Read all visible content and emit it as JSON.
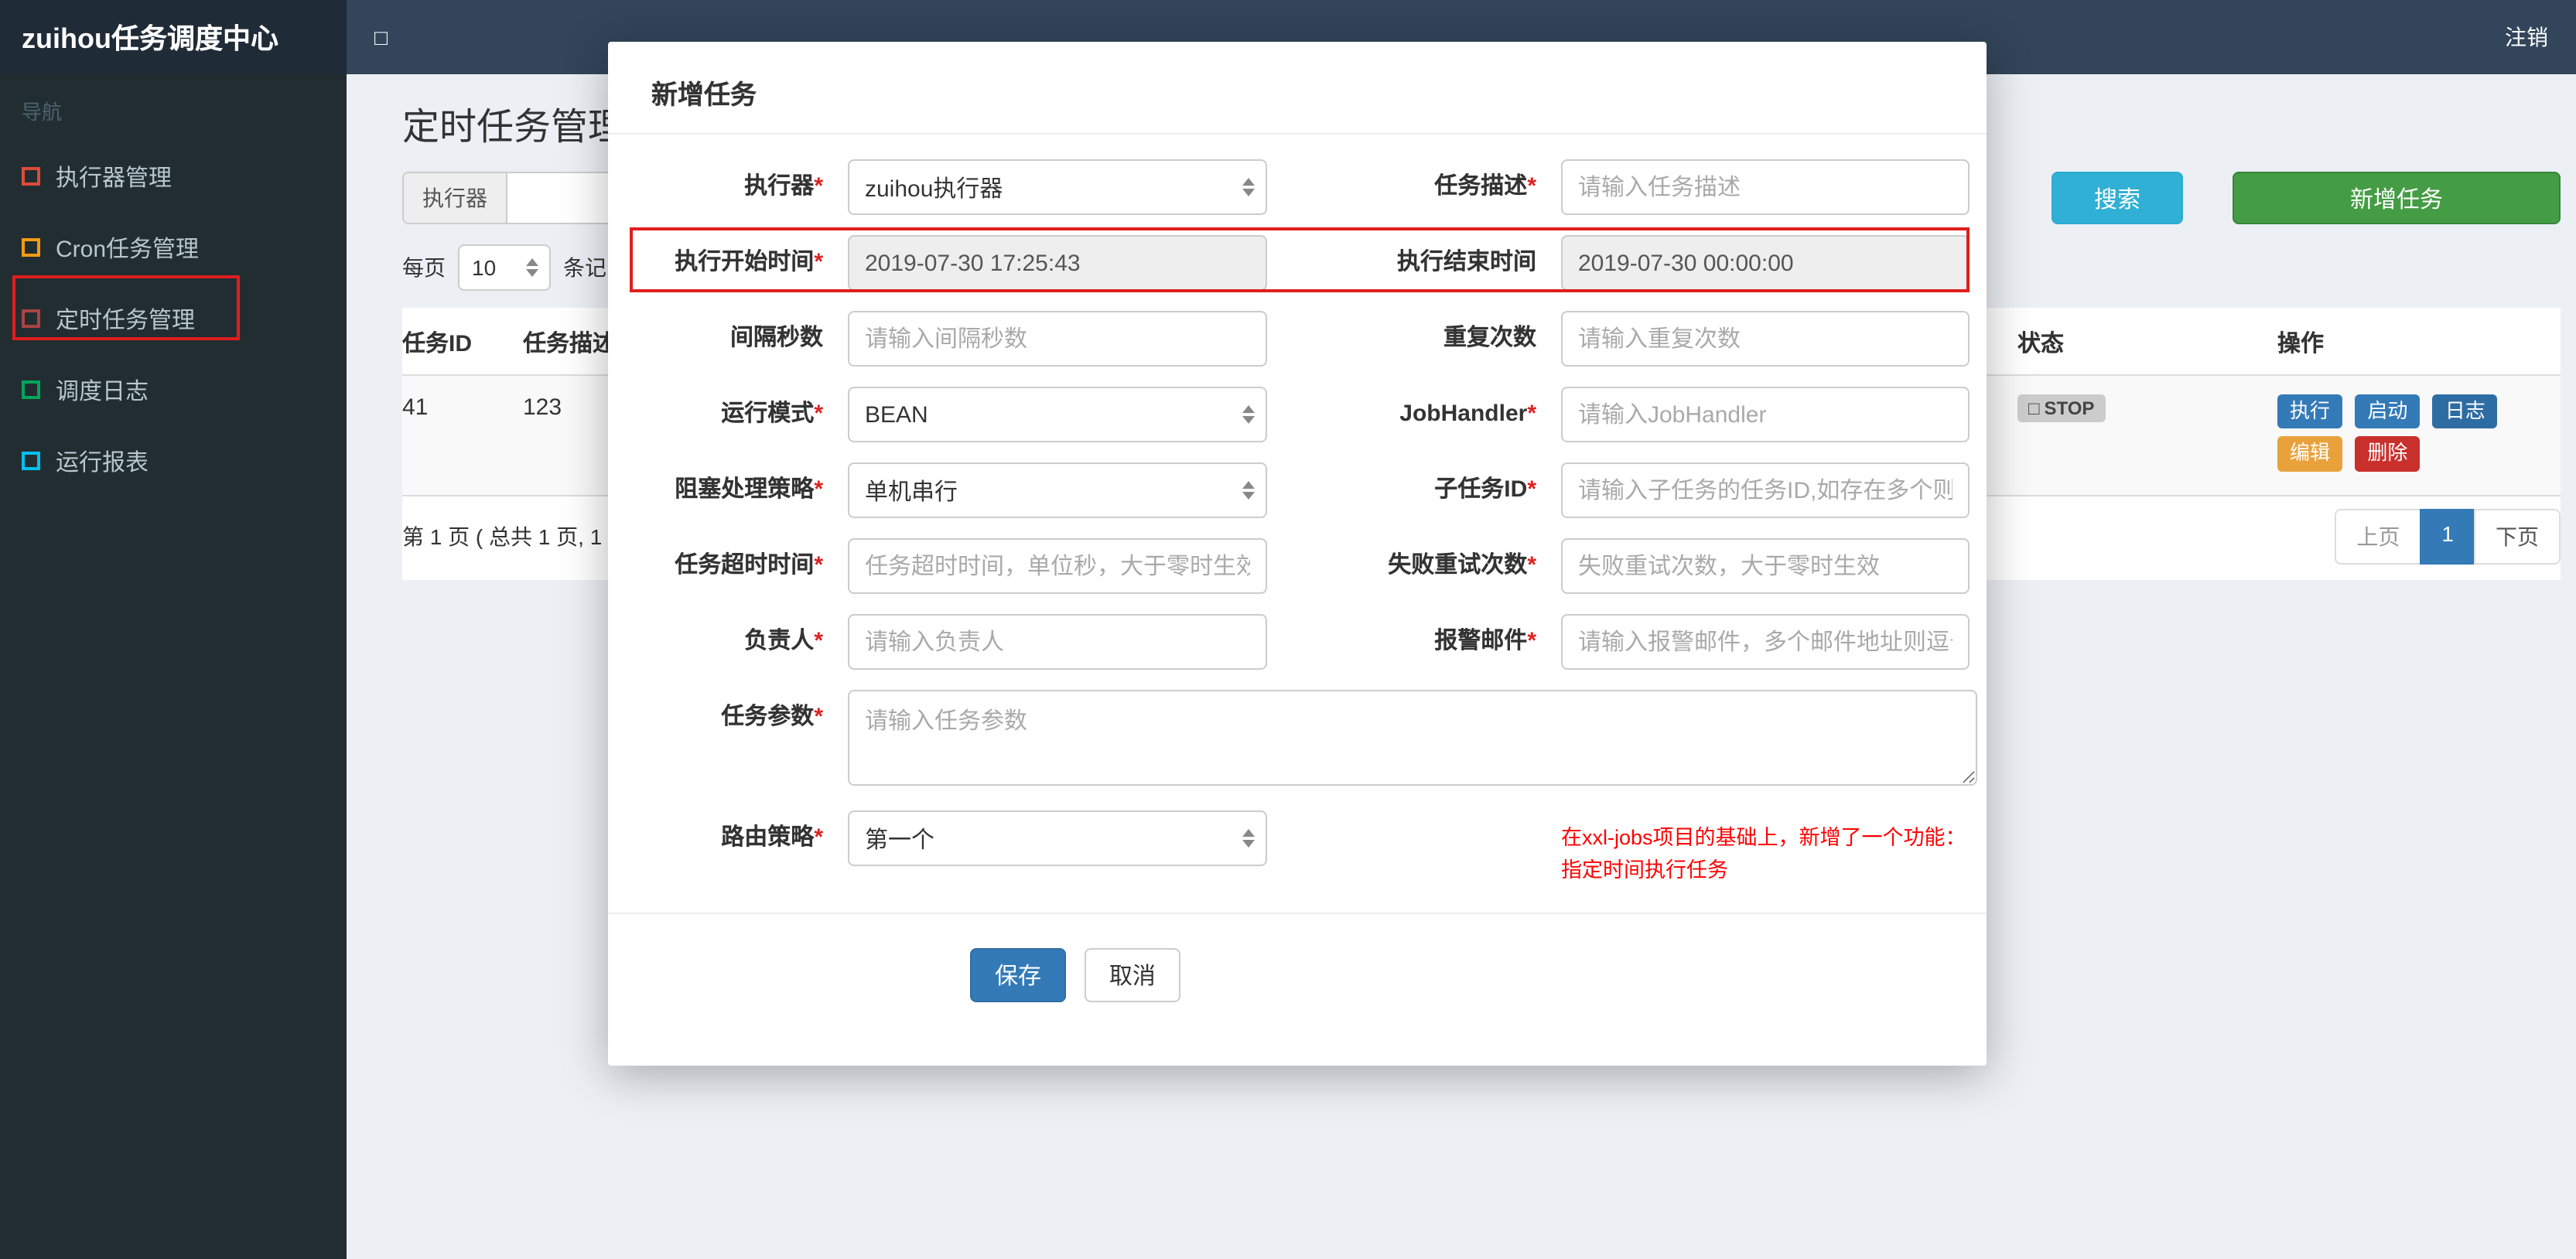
{
  "app": {
    "brand": "zuihou任务调度中心",
    "toggle_icon": "□",
    "logout": "注销"
  },
  "sidebar": {
    "section": "导航",
    "items": [
      {
        "label": "执行器管理",
        "icon_color": "#dd4b39"
      },
      {
        "label": "Cron任务管理",
        "icon_color": "#f39c12"
      },
      {
        "label": "定时任务管理",
        "icon_color": "#a94442"
      },
      {
        "label": "调度日志",
        "icon_color": "#00a65a"
      },
      {
        "label": "运行报表",
        "icon_color": "#00c0ef"
      }
    ]
  },
  "page": {
    "title": "定时任务管理",
    "filter": {
      "executor_addon": "执行器",
      "search": "搜索",
      "add": "新增任务"
    },
    "per_page": {
      "prefix": "每页",
      "value": "10",
      "suffix": "条记录"
    },
    "table": {
      "headers": {
        "id": "任务ID",
        "desc": "任务描述",
        "status": "状态",
        "actions": "操作"
      },
      "row": {
        "id": "41",
        "desc": "123",
        "status_icon": "□",
        "status": "STOP",
        "actions": [
          "执行",
          "启动",
          "日志",
          "编辑",
          "删除"
        ]
      }
    },
    "pagination": {
      "summary": "第 1 页 ( 总共 1 页, 1",
      "prev": "上页",
      "page": "1",
      "next": "下页"
    }
  },
  "modal": {
    "title": "新增任务",
    "fields": {
      "executor": {
        "label": "执行器",
        "mark": "*",
        "value": "zuihou执行器"
      },
      "job_desc": {
        "label": "任务描述",
        "mark": "*",
        "placeholder": "请输入任务描述"
      },
      "start_time": {
        "label": "执行开始时间",
        "mark": "*",
        "value": "2019-07-30 17:25:43"
      },
      "end_time": {
        "label": "执行结束时间",
        "value": "2019-07-30 00:00:00"
      },
      "interval": {
        "label": "间隔秒数",
        "placeholder": "请输入间隔秒数"
      },
      "repeat_count": {
        "label": "重复次数",
        "placeholder": "请输入重复次数"
      },
      "run_mode": {
        "label": "运行模式",
        "mark": "*",
        "value": "BEAN"
      },
      "job_handler": {
        "label": "JobHandler",
        "mark": "*",
        "placeholder": "请输入JobHandler"
      },
      "block_strategy": {
        "label": "阻塞处理策略",
        "mark": "*",
        "value": "单机串行"
      },
      "child_job_id": {
        "label": "子任务ID",
        "mark": "*",
        "placeholder": "请输入子任务的任务ID,如存在多个则逗号分隔"
      },
      "timeout": {
        "label": "任务超时时间",
        "mark": "*",
        "placeholder": "任务超时时间，单位秒，大于零时生效"
      },
      "fail_retry": {
        "label": "失败重试次数",
        "mark": "*",
        "placeholder": "失败重试次数，大于零时生效"
      },
      "owner": {
        "label": "负责人",
        "mark": "*",
        "placeholder": "请输入负责人"
      },
      "alarm_email": {
        "label": "报警邮件",
        "mark": "*",
        "placeholder": "请输入报警邮件，多个邮件地址则逗号分隔"
      },
      "job_param": {
        "label": "任务参数",
        "mark": "*",
        "placeholder": "请输入任务参数"
      },
      "route_strategy": {
        "label": "路由策略",
        "mark": "*",
        "value": "第一个"
      }
    },
    "note": {
      "line1": "在xxl-jobs项目的基础上，新增了一个功能：",
      "line2": "指定时间执行任务"
    },
    "save": "保存",
    "cancel": "取消"
  },
  "colors": {
    "search_button": "#31b0d5",
    "add_button": "#449d44",
    "save_button": "#337ab7",
    "note_text": "#ff0000",
    "annotation": "#e01e1e",
    "btn_execute": "#337ab7",
    "btn_start": "#337ab7",
    "btn_log": "#2e6da4",
    "btn_edit": "#e9a23b",
    "btn_delete": "#c9302c"
  }
}
